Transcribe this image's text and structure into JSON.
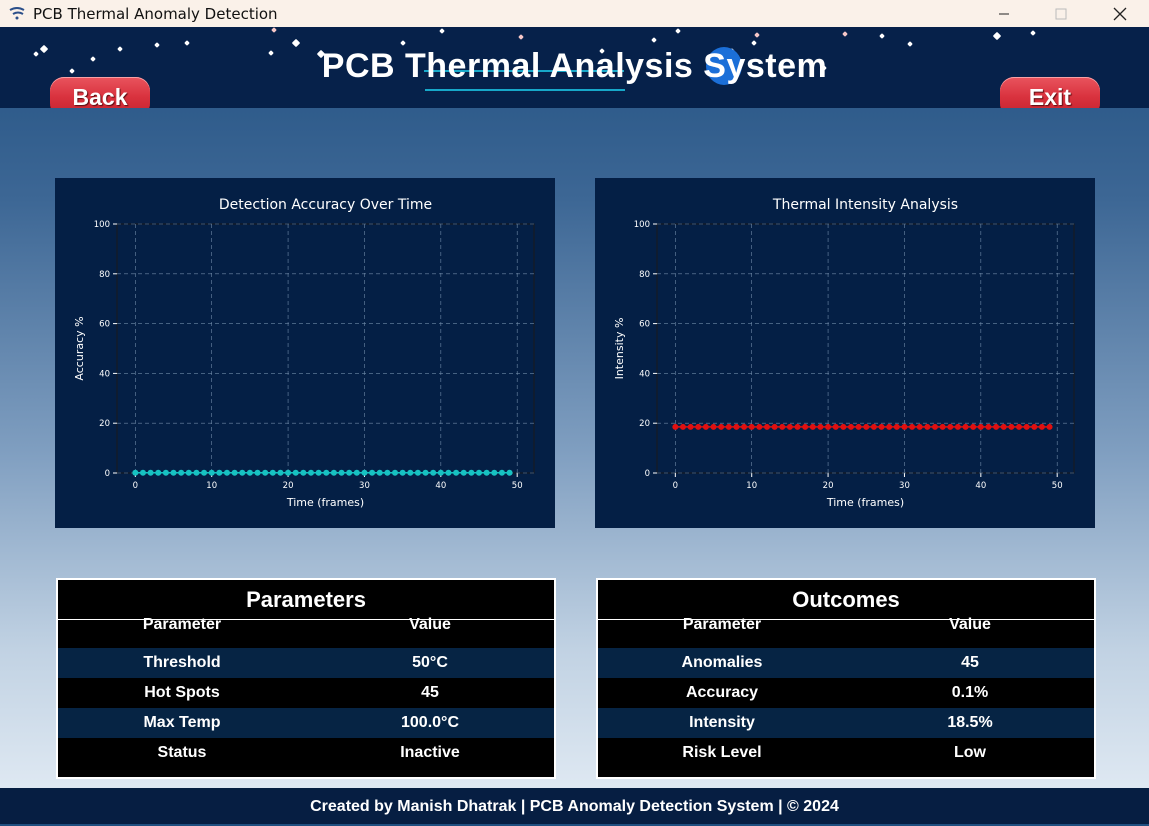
{
  "window": {
    "title": "PCB Thermal Anomaly Detection",
    "minimize_icon": "minimize-icon",
    "maximize_icon": "maximize-icon",
    "close_icon": "close-icon"
  },
  "header": {
    "title": "PCB Thermal Analysis System",
    "back_label": "Back",
    "exit_label": "Exit",
    "background_color": "#06214a",
    "button_color": "#d9323e"
  },
  "chart_data": [
    {
      "type": "line",
      "title": "Detection Accuracy Over Time",
      "xlabel": "Time (frames)",
      "ylabel": "Accuracy %",
      "xlim": [
        -2.4,
        52.2
      ],
      "ylim": [
        0,
        100
      ],
      "xticks": [
        0,
        10,
        20,
        30,
        40,
        50
      ],
      "yticks": [
        0,
        20,
        40,
        60,
        80,
        100
      ],
      "grid": true,
      "series": [
        {
          "color": "#17c2c2",
          "marker": "o",
          "x_start": 0,
          "x_end": 49,
          "y_constant": 0.1
        }
      ]
    },
    {
      "type": "line",
      "title": "Thermal Intensity Analysis",
      "xlabel": "Time (frames)",
      "ylabel": "Intensity %",
      "xlim": [
        -2.4,
        52.2
      ],
      "ylim": [
        0,
        100
      ],
      "xticks": [
        0,
        10,
        20,
        30,
        40,
        50
      ],
      "yticks": [
        0,
        20,
        40,
        60,
        80,
        100
      ],
      "grid": true,
      "series": [
        {
          "color": "#e01010",
          "marker": "o",
          "x_start": 0,
          "x_end": 49,
          "y_constant": 18.5
        }
      ]
    }
  ],
  "parameters": {
    "title": "Parameters",
    "headers": [
      "Parameter",
      "Value"
    ],
    "rows": [
      [
        "Threshold",
        "50°C"
      ],
      [
        "Hot Spots",
        "45"
      ],
      [
        "Max Temp",
        "100.0°C"
      ],
      [
        "Status",
        "Inactive"
      ]
    ]
  },
  "outcomes": {
    "title": "Outcomes",
    "headers": [
      "Parameter",
      "Value"
    ],
    "rows": [
      [
        "Anomalies",
        "45"
      ],
      [
        "Accuracy",
        "0.1%"
      ],
      [
        "Intensity",
        "18.5%"
      ],
      [
        "Risk Level",
        "Low"
      ]
    ]
  },
  "footer": {
    "text": "Created by Manish Dhatrak | PCB Anomaly Detection System | © 2024"
  }
}
